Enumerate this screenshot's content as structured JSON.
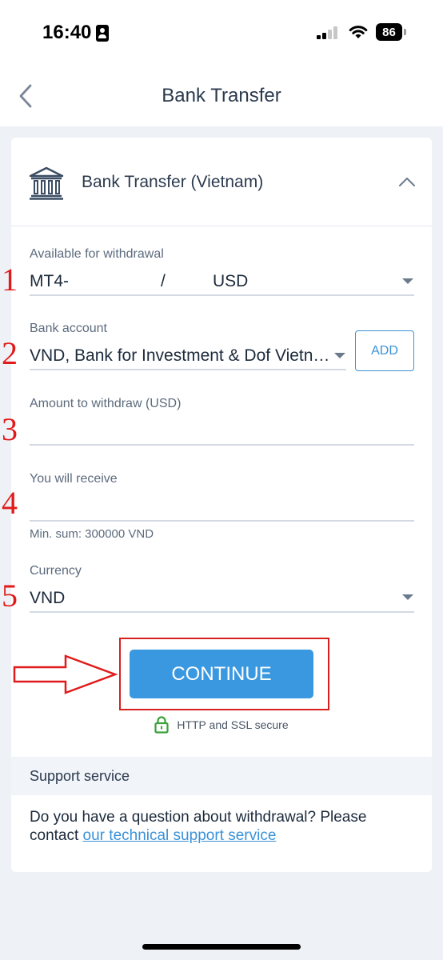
{
  "status_bar": {
    "time": "16:40",
    "battery": "86"
  },
  "nav": {
    "title": "Bank Transfer"
  },
  "method": {
    "title": "Bank Transfer (Vietnam)"
  },
  "fields": {
    "available": {
      "label": "Available for withdrawal",
      "account": "MT4-",
      "separator": "/",
      "currency": "USD"
    },
    "bank_account": {
      "label": "Bank account",
      "value": "VND, Bank for Investment & Dof Vietn…",
      "add_label": "ADD"
    },
    "amount": {
      "label": "Amount to withdraw (USD)",
      "value": ""
    },
    "receive": {
      "label": "You will receive",
      "value": "",
      "min_sum": "Min. sum: 300000 VND"
    },
    "currency": {
      "label": "Currency",
      "value": "VND"
    }
  },
  "steps": [
    "1",
    "2",
    "3",
    "4",
    "5"
  ],
  "actions": {
    "continue_label": "CONTINUE",
    "secure_text": "HTTP and SSL secure"
  },
  "support": {
    "heading": "Support service",
    "text": "Do you have a question about withdrawal? Please contact ",
    "link": "our technical support service"
  },
  "colors": {
    "accent": "#3a98e0",
    "annotation": "#e11b1b"
  }
}
